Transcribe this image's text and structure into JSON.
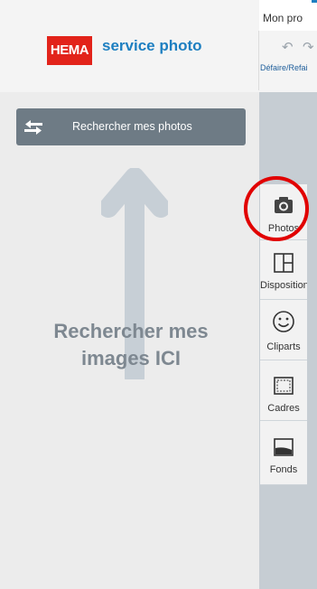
{
  "header": {
    "brand_logo": "HEMA",
    "brand_name": "service photo",
    "project_title": "Mon pro",
    "undo_redo_label": "Défaire/Refai",
    "undo_icon": "undo-arrow-icon",
    "redo_icon": "redo-arrow-icon"
  },
  "panel": {
    "search_button_label": "Rechercher mes photos",
    "search_button_icon": "swap-arrows-icon",
    "hint_text": "Rechercher mes images ICI"
  },
  "tools": [
    {
      "label": "Photos",
      "icon": "camera-icon"
    },
    {
      "label": "Disposition",
      "icon": "layout-icon"
    },
    {
      "label": "Cliparts",
      "icon": "smiley-icon"
    },
    {
      "label": "Cadres",
      "icon": "frame-icon"
    },
    {
      "label": "Fonds",
      "icon": "background-icon"
    }
  ],
  "colors": {
    "brand_red": "#e2231a",
    "brand_blue": "#1d7fc1",
    "search_button": "#6e7b85",
    "highlight_circle": "#e10000"
  }
}
